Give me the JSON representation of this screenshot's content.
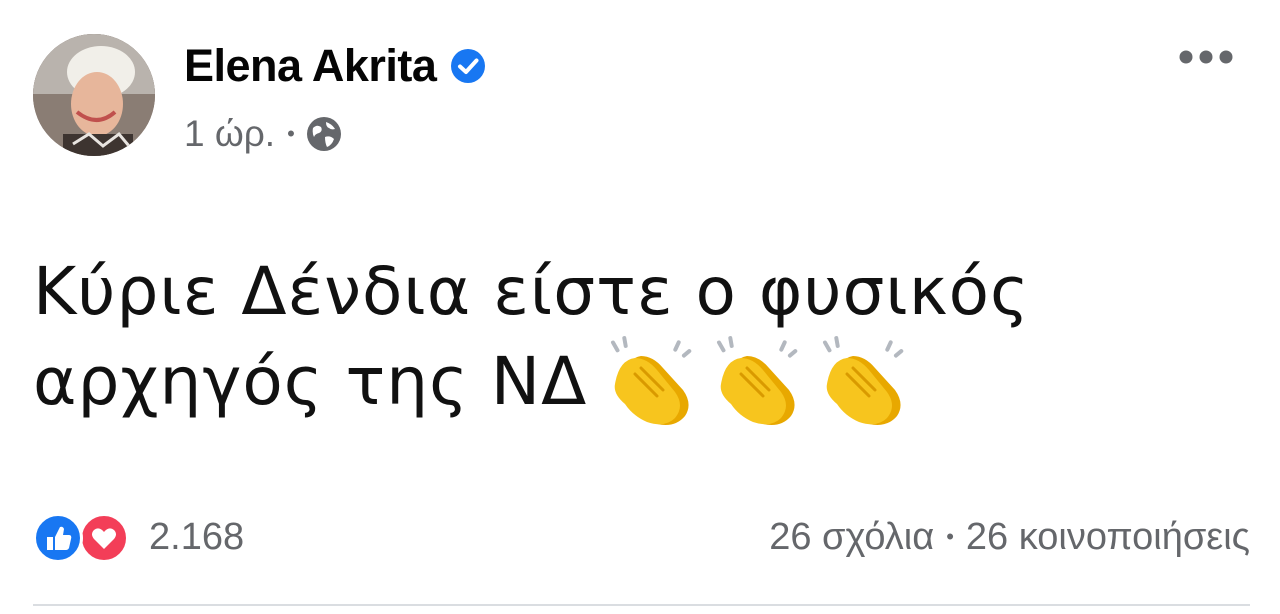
{
  "author": {
    "name": "Elena Akrita",
    "verified": true
  },
  "meta": {
    "time": "1 ώρ.",
    "separator": "•",
    "audience_icon": "globe-icon"
  },
  "post": {
    "text_line1": "Κύριε Δένδια είστε ο φυσικός",
    "text_line2": "αρχηγός της ΝΔ",
    "emojis": [
      "clapping-hands",
      "clapping-hands",
      "clapping-hands"
    ]
  },
  "reactions": {
    "types": [
      "like",
      "love"
    ],
    "count": "2.168"
  },
  "counts": {
    "comments": "26 σχόλια",
    "separator": "•",
    "shares": "26 κοινοποιήσεις"
  },
  "colors": {
    "accent": "#1877f2",
    "love": "#f33e58",
    "secondary_text": "#65676b",
    "clap": "#f7c51e"
  }
}
